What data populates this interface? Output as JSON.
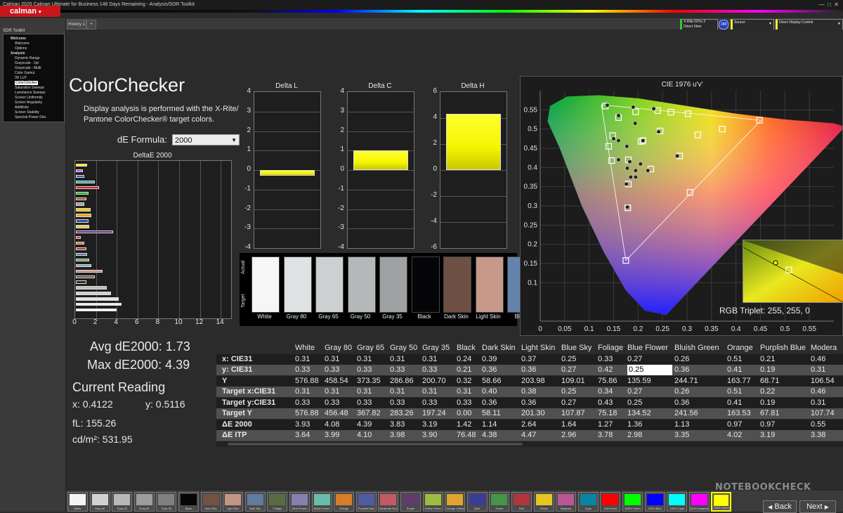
{
  "window": {
    "title": "Calman 2025 Calman Ultimate for Business 146 Days Remaining  -  Analysis/SDR Toolkit"
  },
  "app": {
    "logo_text": "calman"
  },
  "sidebar": {
    "title": "SDR Toolkit",
    "items": [
      "Welcome",
      "Welcome",
      "Options",
      "Analysis",
      "Dynamic Range",
      "Grayscale - 2pt",
      "Grayscale - Multi",
      "Color Gamut",
      "3D LUT",
      "ColorChecker",
      "Saturation Sweeps",
      "Luminance Sweeps",
      "Screen Uniformity",
      "Screen Angularity",
      "Additivity",
      "Screen Stability",
      "Spectral Power Dist."
    ],
    "selected_index": 9
  },
  "tabs": [
    {
      "label": "History 1"
    }
  ],
  "top_controls": {
    "meter_label": "X-Rite i1Pro 2",
    "meter_mode": "Direct View",
    "meter_badge": "288",
    "source_label": "Source",
    "display_label": "Direct Display Control"
  },
  "page": {
    "heading": "ColorChecker",
    "description_line1": "Display analysis is performed with the X-Rite/",
    "description_line2": "Pantone ColorChecker® target colors.",
    "formula_label": "dE Formula:",
    "formula_value": "2000",
    "avg_label": "Avg dE2000: 1.73",
    "max_label": "Max dE2000: 4.39",
    "current_title": "Current Reading",
    "x_reading": "x: 0.4122",
    "y_reading": "y: 0.5116",
    "fl_reading": "fL: 155.26",
    "cdm2_reading": "cd/m²: 531.95"
  },
  "chart_data": [
    {
      "type": "bar",
      "title": "DeltaE 2000",
      "orientation": "horizontal",
      "xlim": [
        0,
        15
      ],
      "xticks": [
        "0",
        "2",
        "4",
        "6",
        "8",
        "10",
        "12",
        "14"
      ],
      "values": [
        1.1,
        0.7,
        0.8,
        1.8,
        2.2,
        1.2,
        1.0,
        0.8,
        1.4,
        1.5,
        1.2,
        1.3,
        3.6,
        0.5,
        0.8,
        1.0,
        1.1,
        1.3,
        1.5,
        2.6,
        1.8,
        1.0,
        3.0,
        3.4,
        4.1,
        4.4,
        3.9
      ],
      "colors": [
        "#f5f500",
        "#d946d9",
        "#2060c0",
        "#20b0a0",
        "#e01010",
        "#20b020",
        "#8a5a2a",
        "#a0a0a0",
        "#f0c800",
        "#f0a020",
        "#3050a0",
        "#e0d040",
        "#5a2e7a",
        "#d03060",
        "#d07020",
        "#c03030",
        "#5a7ab0",
        "#6aa060",
        "#8fa0c0",
        "#c0907a",
        "#6a4a3a",
        "#2a2a2a",
        "#bcbcbc",
        "#d0d0d0",
        "#e4e4e4",
        "#f0f0f0",
        "#fafafa"
      ]
    },
    {
      "type": "bar",
      "title": "Delta L",
      "ylim": [
        -4,
        4
      ],
      "yticks": [
        "4",
        "3",
        "2",
        "1",
        "0",
        "-1",
        "-2",
        "-3",
        "-4"
      ],
      "values": [
        -0.3
      ],
      "color": "#f5f500"
    },
    {
      "type": "bar",
      "title": "Delta C",
      "ylim": [
        -4,
        4
      ],
      "yticks": [
        "4",
        "3",
        "2",
        "1",
        "0",
        "-1",
        "-2",
        "-3",
        "-4"
      ],
      "values": [
        1.0
      ],
      "color": "#f5f500"
    },
    {
      "type": "bar",
      "title": "Delta H",
      "ylim": [
        -6,
        6
      ],
      "yticks": [
        "6",
        "4",
        "2",
        "0",
        "-2",
        "-4",
        "-6"
      ],
      "values": [
        4.3
      ],
      "color": "#f5f500"
    },
    {
      "type": "scatter",
      "title": "CIE 1976 u'v'",
      "xlim": [
        0,
        0.6
      ],
      "ylim": [
        0,
        0.6
      ],
      "xticks": [
        "0",
        "0.05",
        "0.1",
        "0.15",
        "0.2",
        "0.25",
        "0.3",
        "0.35",
        "0.4",
        "0.45",
        "0.5",
        "0.55"
      ],
      "yticks": [
        "0.55",
        "0.5",
        "0.45",
        "0.4",
        "0.35",
        "0.3",
        "0.25",
        "0.2",
        "0.15",
        "0.1"
      ],
      "targets": [
        [
          0.133,
          0.56
        ],
        [
          0.16,
          0.53
        ],
        [
          0.195,
          0.545
        ],
        [
          0.24,
          0.548
        ],
        [
          0.267,
          0.544
        ],
        [
          0.302,
          0.54
        ],
        [
          0.322,
          0.485
        ],
        [
          0.372,
          0.5
        ],
        [
          0.448,
          0.523
        ],
        [
          0.148,
          0.483
        ],
        [
          0.21,
          0.47
        ],
        [
          0.245,
          0.495
        ],
        [
          0.206,
          0.468
        ],
        [
          0.14,
          0.455
        ],
        [
          0.146,
          0.418
        ],
        [
          0.18,
          0.42
        ],
        [
          0.285,
          0.43
        ],
        [
          0.226,
          0.396
        ],
        [
          0.18,
          0.357
        ],
        [
          0.306,
          0.335
        ],
        [
          0.179,
          0.295
        ],
        [
          0.175,
          0.158
        ]
      ],
      "measured": [
        [
          0.137,
          0.562
        ],
        [
          0.16,
          0.535
        ],
        [
          0.19,
          0.557
        ],
        [
          0.194,
          0.515
        ],
        [
          0.232,
          0.553
        ],
        [
          0.242,
          0.493
        ],
        [
          0.21,
          0.47
        ],
        [
          0.177,
          0.455
        ],
        [
          0.16,
          0.47
        ],
        [
          0.16,
          0.42
        ],
        [
          0.183,
          0.415
        ],
        [
          0.205,
          0.409
        ],
        [
          0.15,
          0.475
        ],
        [
          0.28,
          0.43
        ],
        [
          0.178,
          0.398
        ],
        [
          0.22,
          0.392
        ],
        [
          0.185,
          0.375
        ],
        [
          0.195,
          0.392
        ],
        [
          0.176,
          0.357
        ],
        [
          0.178,
          0.297
        ],
        [
          0.195,
          0.375
        ]
      ],
      "inset_label": "RGB Triplet: 255, 255, 0"
    }
  ],
  "swatch_panel": {
    "side_labels": [
      "Actual",
      "Target"
    ],
    "items": [
      {
        "name": "White",
        "color": "#f6f6f6"
      },
      {
        "name": "Gray 80",
        "color": "#dfe2e2"
      },
      {
        "name": "Gray 65",
        "color": "#cdd0d0"
      },
      {
        "name": "Gray 50",
        "color": "#b6b9b9"
      },
      {
        "name": "Gray 35",
        "color": "#9fa2a2"
      },
      {
        "name": "Black",
        "color": "#050508"
      },
      {
        "name": "Dark Skin",
        "color": "#6e5044"
      },
      {
        "name": "Light Skin",
        "color": "#c7998a"
      },
      {
        "name": "Blue",
        "color": "#6484ac"
      }
    ]
  },
  "table": {
    "columns": [
      "White",
      "Gray 80",
      "Gray 65",
      "Gray 50",
      "Gray 35",
      "Black",
      "Dark Skin",
      "Light Skin",
      "Blue Sky",
      "Foliage",
      "Blue Flower",
      "Bluish Green",
      "Orange",
      "Purplish Blue",
      "Modera"
    ],
    "rows": [
      {
        "label": "x: CIE31",
        "values": [
          "0.31",
          "0.31",
          "0.31",
          "0.31",
          "0.31",
          "0.24",
          "0.39",
          "0.37",
          "0.25",
          "0.33",
          "0.27",
          "0.26",
          "0.51",
          "0.21",
          "0.46"
        ]
      },
      {
        "label": "y: CIE31",
        "values": [
          "0.33",
          "0.33",
          "0.33",
          "0.33",
          "0.33",
          "0.21",
          "0.36",
          "0.36",
          "0.27",
          "0.42",
          "0.25",
          "0.36",
          "0.41",
          "0.19",
          "0.31"
        ]
      },
      {
        "label": "Y",
        "values": [
          "576.88",
          "458.54",
          "373.35",
          "286.86",
          "200.70",
          "0.32",
          "58.66",
          "203.98",
          "109.01",
          "75.86",
          "135.59",
          "244.71",
          "163.77",
          "68.71",
          "106.54"
        ]
      },
      {
        "label": "Target x:CIE31",
        "values": [
          "0.31",
          "0.31",
          "0.31",
          "0.31",
          "0.31",
          "0.31",
          "0.40",
          "0.38",
          "0.25",
          "0.34",
          "0.27",
          "0.26",
          "0.51",
          "0.22",
          "0.46"
        ]
      },
      {
        "label": "Target y:CIE31",
        "values": [
          "0.33",
          "0.33",
          "0.33",
          "0.33",
          "0.33",
          "0.33",
          "0.36",
          "0.36",
          "0.27",
          "0.43",
          "0.25",
          "0.36",
          "0.41",
          "0.19",
          "0.31"
        ]
      },
      {
        "label": "Target Y",
        "values": [
          "576.88",
          "456.48",
          "367.82",
          "283.26",
          "197.24",
          "0.00",
          "58.11",
          "201.30",
          "107.87",
          "75.18",
          "134.52",
          "241.56",
          "163.53",
          "67.81",
          "107.74"
        ]
      },
      {
        "label": "ΔE 2000",
        "values": [
          "3.93",
          "4.08",
          "4.39",
          "3.83",
          "3.19",
          "1.42",
          "1.14",
          "2.64",
          "1.64",
          "1.27",
          "1.36",
          "1.13",
          "0.97",
          "0.97",
          "0.55"
        ]
      },
      {
        "label": "ΔE ITP",
        "values": [
          "3.64",
          "3.99",
          "4.10",
          "3.98",
          "3.90",
          "76.48",
          "4.38",
          "4.47",
          "2.96",
          "3.78",
          "2.98",
          "3.35",
          "4.02",
          "3.19",
          "3.38"
        ]
      }
    ]
  },
  "bottom_swatches": [
    {
      "label": "White",
      "color": "#f4f4f4"
    },
    {
      "label": "Gray 80",
      "color": "#d2d2d2"
    },
    {
      "label": "Gray 65",
      "color": "#b8b8b8"
    },
    {
      "label": "Gray 50",
      "color": "#9c9c9c"
    },
    {
      "label": "Gray 35",
      "color": "#808080"
    },
    {
      "label": "Black",
      "color": "#050505"
    },
    {
      "label": "Dark Skin",
      "color": "#735244"
    },
    {
      "label": "Light Skin",
      "color": "#c29682"
    },
    {
      "label": "Blue Sky",
      "color": "#627a9d"
    },
    {
      "label": "Foliage",
      "color": "#576c43"
    },
    {
      "label": "Blue Flower",
      "color": "#8580b1"
    },
    {
      "label": "Bluish Green",
      "color": "#67bdaa"
    },
    {
      "label": "Orange",
      "color": "#d67e2c"
    },
    {
      "label": "Purplish Blue",
      "color": "#505ba6"
    },
    {
      "label": "Moderate Red",
      "color": "#c15a63"
    },
    {
      "label": "Purple",
      "color": "#5e3c6c"
    },
    {
      "label": "Yellow Green",
      "color": "#9dbc40"
    },
    {
      "label": "Orange Yellow",
      "color": "#e0a32e"
    },
    {
      "label": "Blue",
      "color": "#383d96"
    },
    {
      "label": "Green",
      "color": "#469449"
    },
    {
      "label": "Red",
      "color": "#af363c"
    },
    {
      "label": "Yellow",
      "color": "#e7c71f"
    },
    {
      "label": "Magenta",
      "color": "#bb5695"
    },
    {
      "label": "Cyan",
      "color": "#0885a1"
    },
    {
      "label": "100% Red",
      "color": "#ff0000"
    },
    {
      "label": "100% Green",
      "color": "#00ff00"
    },
    {
      "label": "100% Blue",
      "color": "#0000ff"
    },
    {
      "label": "100% Cyan",
      "color": "#00ffff"
    },
    {
      "label": "100% Magenta",
      "color": "#ff00ff"
    },
    {
      "label": "100% Yellow",
      "color": "#ffff00"
    }
  ],
  "nav": {
    "back_label": "Back",
    "next_label": "Next"
  },
  "watermark": {
    "text": "NOTEBOOKCHECK"
  }
}
